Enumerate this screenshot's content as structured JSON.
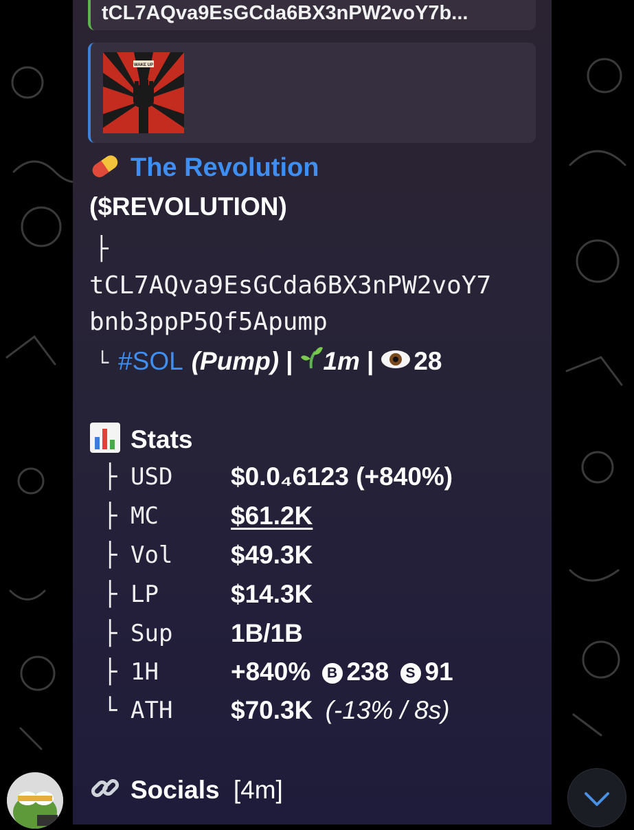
{
  "reply": {
    "text": "tCL7AQva9EsGCda6BX3nPW2voY7b..."
  },
  "preview": {
    "image_text": "WAKE UP"
  },
  "token": {
    "name": "The Revolution",
    "ticker": "($REVOLUTION)",
    "address_line1": "tCL7AQva9EsGCda6BX3nPW2voY7",
    "address_line2": "bnb3ppP5Qf5Apump",
    "chain_tag": "#SOL",
    "platform": "(Pump)",
    "separator": "|",
    "age": "1m",
    "views": "28"
  },
  "stats": {
    "heading": "Stats",
    "rows": [
      {
        "branch": "├",
        "label": "USD",
        "value": "$0.0₄6123 (+840%)"
      },
      {
        "branch": "├",
        "label": "MC",
        "value": "$61.2K"
      },
      {
        "branch": "├",
        "label": "Vol",
        "value": "$49.3K"
      },
      {
        "branch": "├",
        "label": "LP",
        "value": "$14.3K"
      },
      {
        "branch": "├",
        "label": "Sup",
        "value": "1B/1B"
      },
      {
        "branch": "├",
        "label": "1H",
        "value": "+840%",
        "buys": "238",
        "sells": "91"
      },
      {
        "branch": "└",
        "label": "ATH",
        "value": "$70.3K",
        "note": "(-13% / 8s)"
      }
    ]
  },
  "socials": {
    "heading": "Socials",
    "age": "[4m]"
  },
  "colors": {
    "link": "#3f8ef1",
    "reply_bar": "#5fb34f",
    "preview_bar": "#3d82d8"
  }
}
